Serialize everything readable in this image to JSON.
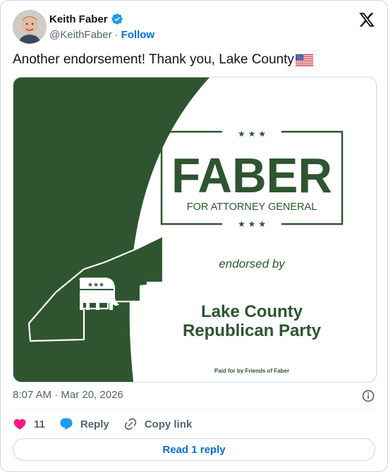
{
  "author": {
    "name": "Keith Faber",
    "handle": "@KeithFaber",
    "separator": "·",
    "follow_label": "Follow",
    "verified_color": "#1d9bf0"
  },
  "platform_icon": "x-logo-icon",
  "tweet": {
    "text": "Another endorsement! Thank you, Lake County",
    "emoji": "us-flag-emoji"
  },
  "media": {
    "brand_color": "#2f5430",
    "stars_top": "★ ★ ★",
    "headline": "FABER",
    "subtitle": "FOR ATTORNEY GENERAL",
    "stars_bottom": "★ ★ ★",
    "endorsed_by": "endorsed by",
    "org_line1": "Lake County",
    "org_line2": "Republican Party",
    "disclaimer": "Paid for by Friends of Faber",
    "emblem_icon": "gop-elephant-icon",
    "map_icon": "lake-county-outline-icon"
  },
  "meta": {
    "timestamp": "8:07 AM · Mar 20, 2026"
  },
  "actions": {
    "like_count": "11",
    "reply_label": "Reply",
    "copy_label": "Copy link",
    "like_color": "#f91880",
    "accent_color": "#1d9bf0"
  },
  "read_replies_label": "Read 1 reply"
}
